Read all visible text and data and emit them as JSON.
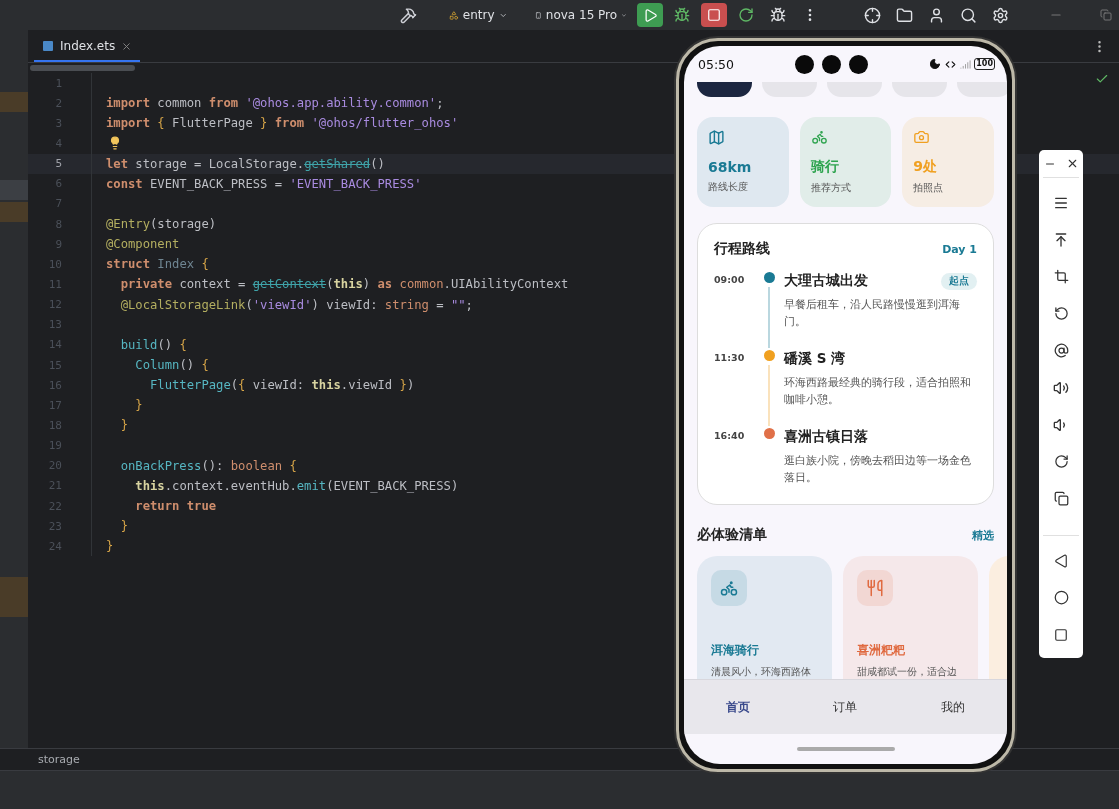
{
  "toolbar": {
    "module": "entry",
    "device": "nova 15 Pro"
  },
  "editor": {
    "tab": {
      "label": "Index.ets",
      "selected": true
    },
    "lines": [
      {
        "number": "1",
        "current": false,
        "hint": false
      },
      {
        "number": "2",
        "current": false,
        "hint": false,
        "tokens": [
          {
            "text": "import",
            "kind": "kw"
          },
          {
            "text": " common ",
            "kind": "plain"
          },
          {
            "text": "from",
            "kind": "kw"
          },
          {
            "text": " '@ohos.app.ability.common'",
            "kind": "str"
          },
          {
            "text": ";",
            "kind": "plain"
          }
        ]
      },
      {
        "number": "3",
        "current": false,
        "hint": false,
        "tokens": [
          {
            "text": "import",
            "kind": "kw"
          },
          {
            "text": " { ",
            "kind": "brace"
          },
          {
            "text": "FlutterPage",
            "kind": "plain"
          },
          {
            "text": " } ",
            "kind": "brace"
          },
          {
            "text": "from",
            "kind": "kw"
          },
          {
            "text": " '@ohos/flutter_ohos'",
            "kind": "str"
          }
        ]
      },
      {
        "number": "4",
        "current": false,
        "hint": true
      },
      {
        "number": "5",
        "current": true,
        "hint": false,
        "tokens": [
          {
            "text": "let",
            "kind": "kw"
          },
          {
            "text": " storage = LocalStorage.",
            "kind": "plain"
          },
          {
            "text": "getShared",
            "kind": "strike"
          },
          {
            "text": "()",
            "kind": "plain"
          }
        ]
      },
      {
        "number": "6",
        "current": false,
        "hint": false,
        "tokens": [
          {
            "text": "const",
            "kind": "kw"
          },
          {
            "text": " EVENT_BACK_PRESS = ",
            "kind": "plain"
          },
          {
            "text": "'EVENT_BACK_PRESS'",
            "kind": "str"
          }
        ]
      },
      {
        "number": "7",
        "current": false,
        "hint": false
      },
      {
        "number": "8",
        "current": false,
        "hint": false,
        "tokens": [
          {
            "text": "@Entry",
            "kind": "deco"
          },
          {
            "text": "(storage)",
            "kind": "plain"
          }
        ]
      },
      {
        "number": "9",
        "current": false,
        "hint": false,
        "tokens": [
          {
            "text": "@Component",
            "kind": "deco"
          }
        ]
      },
      {
        "number": "10",
        "current": false,
        "hint": false,
        "tokens": [
          {
            "text": "struct",
            "kind": "kw"
          },
          {
            "text": " Index",
            "kind": "dim"
          },
          {
            "text": " {",
            "kind": "brace"
          }
        ]
      },
      {
        "number": "11",
        "current": false,
        "hint": false,
        "tokens": [
          {
            "text": "  private",
            "kind": "kw"
          },
          {
            "text": " context = ",
            "kind": "plain"
          },
          {
            "text": "getContext",
            "kind": "strike"
          },
          {
            "text": "(",
            "kind": "plain"
          },
          {
            "text": "this",
            "kind": "this"
          },
          {
            "text": ") ",
            "kind": "plain"
          },
          {
            "text": "as",
            "kind": "kw"
          },
          {
            "text": " common",
            "kind": "type"
          },
          {
            "text": ".UIAbilityContext",
            "kind": "plain"
          }
        ]
      },
      {
        "number": "12",
        "current": false,
        "hint": false,
        "tokens": [
          {
            "text": "  @LocalStorageLink",
            "kind": "deco"
          },
          {
            "text": "(",
            "kind": "plain"
          },
          {
            "text": "'viewId'",
            "kind": "str"
          },
          {
            "text": ") viewId: ",
            "kind": "plain"
          },
          {
            "text": "string",
            "kind": "type"
          },
          {
            "text": " = ",
            "kind": "plain"
          },
          {
            "text": "\"\"",
            "kind": "str"
          },
          {
            "text": ";",
            "kind": "plain"
          }
        ]
      },
      {
        "number": "13",
        "current": false,
        "hint": false
      },
      {
        "number": "14",
        "current": false,
        "hint": false,
        "tokens": [
          {
            "text": "  build",
            "kind": "fn"
          },
          {
            "text": "() ",
            "kind": "plain"
          },
          {
            "text": "{",
            "kind": "brace"
          }
        ]
      },
      {
        "number": "15",
        "current": false,
        "hint": false,
        "tokens": [
          {
            "text": "    Column",
            "kind": "fn"
          },
          {
            "text": "() ",
            "kind": "plain"
          },
          {
            "text": "{",
            "kind": "brace"
          }
        ]
      },
      {
        "number": "16",
        "current": false,
        "hint": false,
        "tokens": [
          {
            "text": "      FlutterPage",
            "kind": "fn"
          },
          {
            "text": "(",
            "kind": "plain"
          },
          {
            "text": "{",
            "kind": "brace"
          },
          {
            "text": " viewId: ",
            "kind": "plain"
          },
          {
            "text": "this",
            "kind": "this"
          },
          {
            "text": ".viewId ",
            "kind": "plain"
          },
          {
            "text": "}",
            "kind": "brace"
          },
          {
            "text": ")",
            "kind": "plain"
          }
        ]
      },
      {
        "number": "17",
        "current": false,
        "hint": false,
        "tokens": [
          {
            "text": "    }",
            "kind": "brace"
          }
        ]
      },
      {
        "number": "18",
        "current": false,
        "hint": false,
        "tokens": [
          {
            "text": "  }",
            "kind": "brace"
          }
        ]
      },
      {
        "number": "19",
        "current": false,
        "hint": false
      },
      {
        "number": "20",
        "current": false,
        "hint": false,
        "tokens": [
          {
            "text": "  onBackPress",
            "kind": "fn"
          },
          {
            "text": "(): ",
            "kind": "plain"
          },
          {
            "text": "boolean",
            "kind": "type"
          },
          {
            "text": " {",
            "kind": "brace"
          }
        ]
      },
      {
        "number": "21",
        "current": false,
        "hint": false,
        "tokens": [
          {
            "text": "    this",
            "kind": "this"
          },
          {
            "text": ".context.eventHub.",
            "kind": "plain"
          },
          {
            "text": "emit",
            "kind": "fn"
          },
          {
            "text": "(EVENT_BACK_PRESS)",
            "kind": "plain"
          }
        ]
      },
      {
        "number": "22",
        "current": false,
        "hint": false,
        "tokens": [
          {
            "text": "    return",
            "kind": "kw"
          },
          {
            "text": " true",
            "kind": "kw"
          }
        ]
      },
      {
        "number": "23",
        "current": false,
        "hint": false,
        "tokens": [
          {
            "text": "  }",
            "kind": "brace"
          }
        ]
      },
      {
        "number": "24",
        "current": false,
        "hint": false,
        "tokens": [
          {
            "text": "}",
            "kind": "brace"
          }
        ]
      }
    ]
  },
  "status_bar": {
    "text": "storage"
  },
  "phone": {
    "time": "05:50",
    "battery": "100",
    "chips": [
      {
        "selected": true
      },
      {
        "selected": false
      },
      {
        "selected": false
      },
      {
        "selected": false
      },
      {
        "selected": false
      }
    ],
    "stats": [
      {
        "kind": "map",
        "value": "68km",
        "label": "路线长度",
        "color": "#1a7a94"
      },
      {
        "kind": "bike",
        "value": "骑行",
        "label": "推荐方式",
        "color": "#2ea44f"
      },
      {
        "kind": "camera",
        "value": "9处",
        "label": "拍照点",
        "color": "#f0a020"
      }
    ],
    "route": {
      "title": "行程路线",
      "badge": "Day 1",
      "stops": [
        {
          "time": "09:00",
          "title": "大理古城出发",
          "desc": "早餐后租车，沿人民路慢慢逛到洱海门。",
          "tag": "起点",
          "color": "#1a7a94"
        },
        {
          "time": "11:30",
          "title": "磻溪 S 湾",
          "desc": "环海西路最经典的骑行段，适合拍照和咖啡小憩。",
          "color": "#f0a020"
        },
        {
          "time": "16:40",
          "title": "喜洲古镇日落",
          "desc": "逛白族小院，傍晚去稻田边等一场金色落日。",
          "color": "#e07048"
        }
      ]
    },
    "section": {
      "title": "必体验清单",
      "link": "精选"
    },
    "experiences": [
      {
        "kind": "bike",
        "title": "洱海骑行",
        "desc": "清晨风小，环海西路体",
        "color": "#1a7a94"
      },
      {
        "kind": "food",
        "title": "喜洲粑粑",
        "desc": "甜咸都试一份，适合边",
        "color": "#e06a40"
      },
      {
        "kind": "blank"
      }
    ],
    "nav": [
      {
        "label": "首页",
        "selected": true
      },
      {
        "label": "订单",
        "selected": false
      },
      {
        "label": "我的",
        "selected": false
      }
    ]
  }
}
